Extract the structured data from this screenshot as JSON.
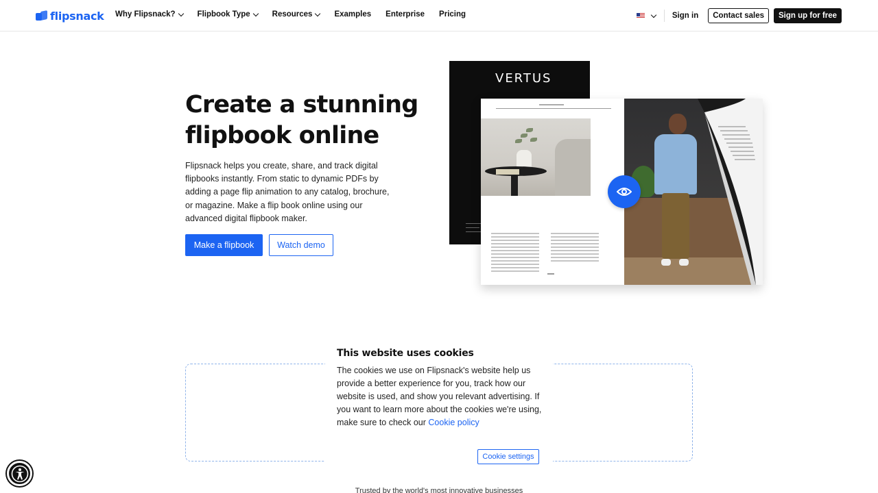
{
  "brand": {
    "name": "flipsnack",
    "color": "#1c64f2"
  },
  "nav": {
    "items": [
      {
        "label": "Why Flipsnack?",
        "dropdown": true
      },
      {
        "label": "Flipbook Type",
        "dropdown": true
      },
      {
        "label": "Resources",
        "dropdown": true
      },
      {
        "label": "Examples",
        "dropdown": false
      },
      {
        "label": "Enterprise",
        "dropdown": false
      },
      {
        "label": "Pricing",
        "dropdown": false
      }
    ],
    "language_flag": "us-flag-icon",
    "signin": "Sign in",
    "contact_sales": "Contact sales",
    "signup": "Sign up for free"
  },
  "hero": {
    "title": "Create a stunning flipbook online",
    "description": "Flipsnack helps you create, share, and track digital flipbooks instantly. From static to dynamic PDFs by adding a page flip animation to any catalog, brochure, or magazine. Make a flip book online using our advanced digital flipbook maker.",
    "primary_button": "Make a flipbook",
    "secondary_button": "Watch demo"
  },
  "illustration": {
    "magazine_title": "VERTUS",
    "preview_icon": "eye-icon"
  },
  "cookie_banner": {
    "title": "This website uses cookies",
    "text": "The cookies we use on Flipsnack's website help us provide a better experience for you, track how our website is used, and show you relevant advertising. If you want to learn more about the cookies we're using, make sure to check our",
    "link": "Cookie policy",
    "settings_button": "Cookie settings"
  },
  "trusted_text": "Trusted by the world's most innovative businesses",
  "accessibility_icon": "accessibility-icon"
}
